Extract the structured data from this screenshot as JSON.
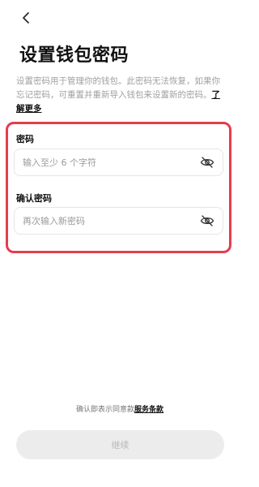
{
  "header": {
    "title": "设置钱包密码",
    "back_icon": "chevron-left-icon"
  },
  "description": {
    "text": "设置密码用于管理你的钱包。此密码无法恢复，如果你忘记密码，可重置并重新导入钱包来设置新的密码。",
    "learn_more": "了解更多"
  },
  "form": {
    "password": {
      "label": "密码",
      "placeholder": "输入至少 6 个字符",
      "value": "",
      "visibility_icon": "eye-slash-icon"
    },
    "confirm": {
      "label": "确认密码",
      "placeholder": "再次输入新密码",
      "value": "",
      "visibility_icon": "eye-slash-icon"
    },
    "highlight_color": "#e43d4e"
  },
  "footer": {
    "terms_prefix": "确认即表示同意款",
    "terms_link": "服务条款",
    "continue_label": "继续"
  }
}
